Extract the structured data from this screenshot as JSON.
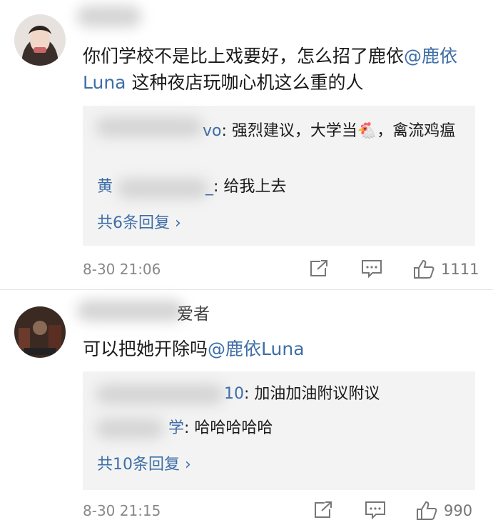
{
  "comments": [
    {
      "username_suffix": "",
      "text_before": "你们学校不是比上戏要好，怎么招了鹿依",
      "mention": "@鹿依Luna",
      "text_after": " 这种夜店玩咖心机这么重的人",
      "replies": [
        {
          "name_visible": "vo",
          "text": ": 强烈建议，大学当🐔，禽流鸡瘟"
        },
        {
          "name_visible": "黄",
          "name_end": "_",
          "text": ": 给我上去"
        }
      ],
      "more_replies": "共6条回复 ›",
      "timestamp": "8-30 21:06",
      "likes": "1111"
    },
    {
      "username_suffix": "爱者",
      "text_before": "可以把她开除吗",
      "mention": "@鹿依Luna",
      "text_after": "",
      "replies": [
        {
          "name_visible": "10",
          "text": ": 加油加油附议附议"
        },
        {
          "name_visible": "学",
          "text": ": 哈哈哈哈哈"
        }
      ],
      "more_replies": "共10条回复 ›",
      "timestamp": "8-30 21:15",
      "likes": "990"
    }
  ],
  "colors": {
    "link": "#3e6ea7",
    "meta": "#888888",
    "reply_bg": "#f3f3f3"
  },
  "icons": [
    "share-icon",
    "comment-icon",
    "like-icon"
  ]
}
